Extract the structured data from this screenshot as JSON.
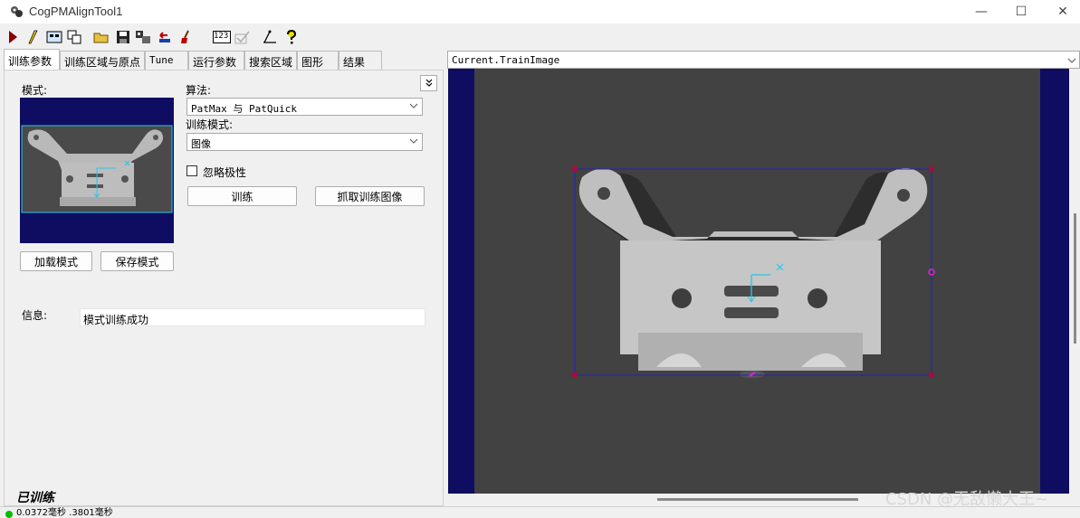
{
  "window": {
    "title": "CogPMAlignTool1",
    "minimize": "—",
    "maximize": "☐",
    "close": "✕"
  },
  "toolbar": {
    "icons": [
      "run-icon",
      "edit-icon",
      "display-icon",
      "copy-icon",
      "open-folder-icon",
      "save-icon",
      "config-icon",
      "reset-icon",
      "clear-icon",
      "counter-icon",
      "check-icon",
      "measure-icon",
      "help-icon"
    ],
    "counter_text": "123"
  },
  "tabs": [
    "训练参数",
    "训练区域与原点",
    "Tune",
    "运行参数",
    "搜索区域",
    "图形",
    "结果"
  ],
  "left": {
    "model_label": "模式:",
    "algorithm_label": "算法:",
    "algorithm_value": "PatMax 与 PatQuick",
    "train_mode_label": "训练模式:",
    "train_mode_value": "图像",
    "ignore_polarity_label": "忽略极性",
    "ignore_polarity_checked": false,
    "train_button": "训练",
    "grab_train_image_button": "抓取训练图像",
    "load_model_button": "加载模式",
    "save_model_button": "保存模式",
    "info_label": "信息:",
    "info_value": "模式训练成功",
    "trained_status": "已训练",
    "collapse_icon": "chevron-down-icon"
  },
  "viewer": {
    "image_select": "Current.TrainImage"
  },
  "status": {
    "text": "0.0372毫秒  .3801毫秒",
    "indicator_color": "#00c000"
  },
  "watermark": "CSDN @无敌懒大王~",
  "colors": {
    "viewer_bg": "#0e0d62",
    "region_line": "#2323c8",
    "handle": "#a0103a",
    "origin": "#27c6e6",
    "rotate_handle": "#e020e0"
  }
}
